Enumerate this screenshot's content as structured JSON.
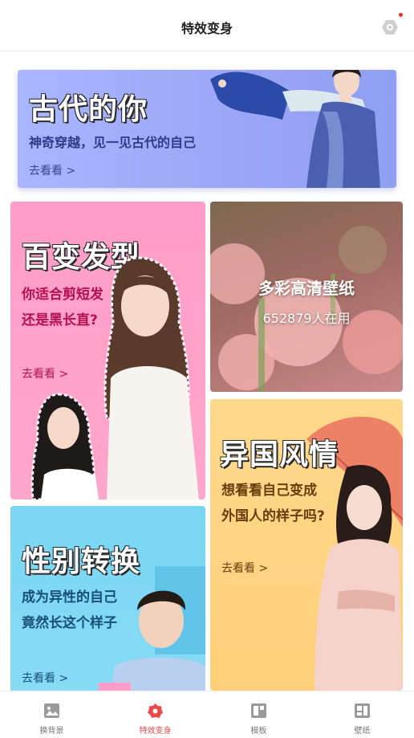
{
  "header": {
    "title": "特效变身"
  },
  "icons": {
    "settings": "gear-icon"
  },
  "colors": {
    "accent": "#e84a47",
    "notification_dot": "#e8312e"
  },
  "cards": {
    "ancient": {
      "title": "古代的你",
      "subtitle": "神奇穿越，见一见古代的自己",
      "link": "去看看 >"
    },
    "hair": {
      "title": "百变发型",
      "line1": "你适合剪短发",
      "line2": "还是黑长直?",
      "link": "去看看 >"
    },
    "wallpaper": {
      "title": "多彩高清壁纸",
      "count": "652879人在用"
    },
    "exotic": {
      "title": "异国风情",
      "line1": "想看看自己变成",
      "line2": "外国人的样子吗?",
      "link": "去看看 >"
    },
    "gender": {
      "title": "性别转换",
      "line1": "成为异性的自己",
      "line2": "竟然长这个样子",
      "link": "去看看 >"
    }
  },
  "tabs": [
    {
      "label": "换背景",
      "icon": "image-icon",
      "active": false
    },
    {
      "label": "特效变身",
      "icon": "flower-icon",
      "active": true
    },
    {
      "label": "模板",
      "icon": "template-icon",
      "active": false
    },
    {
      "label": "壁纸",
      "icon": "wallpaper-icon",
      "active": false
    }
  ]
}
